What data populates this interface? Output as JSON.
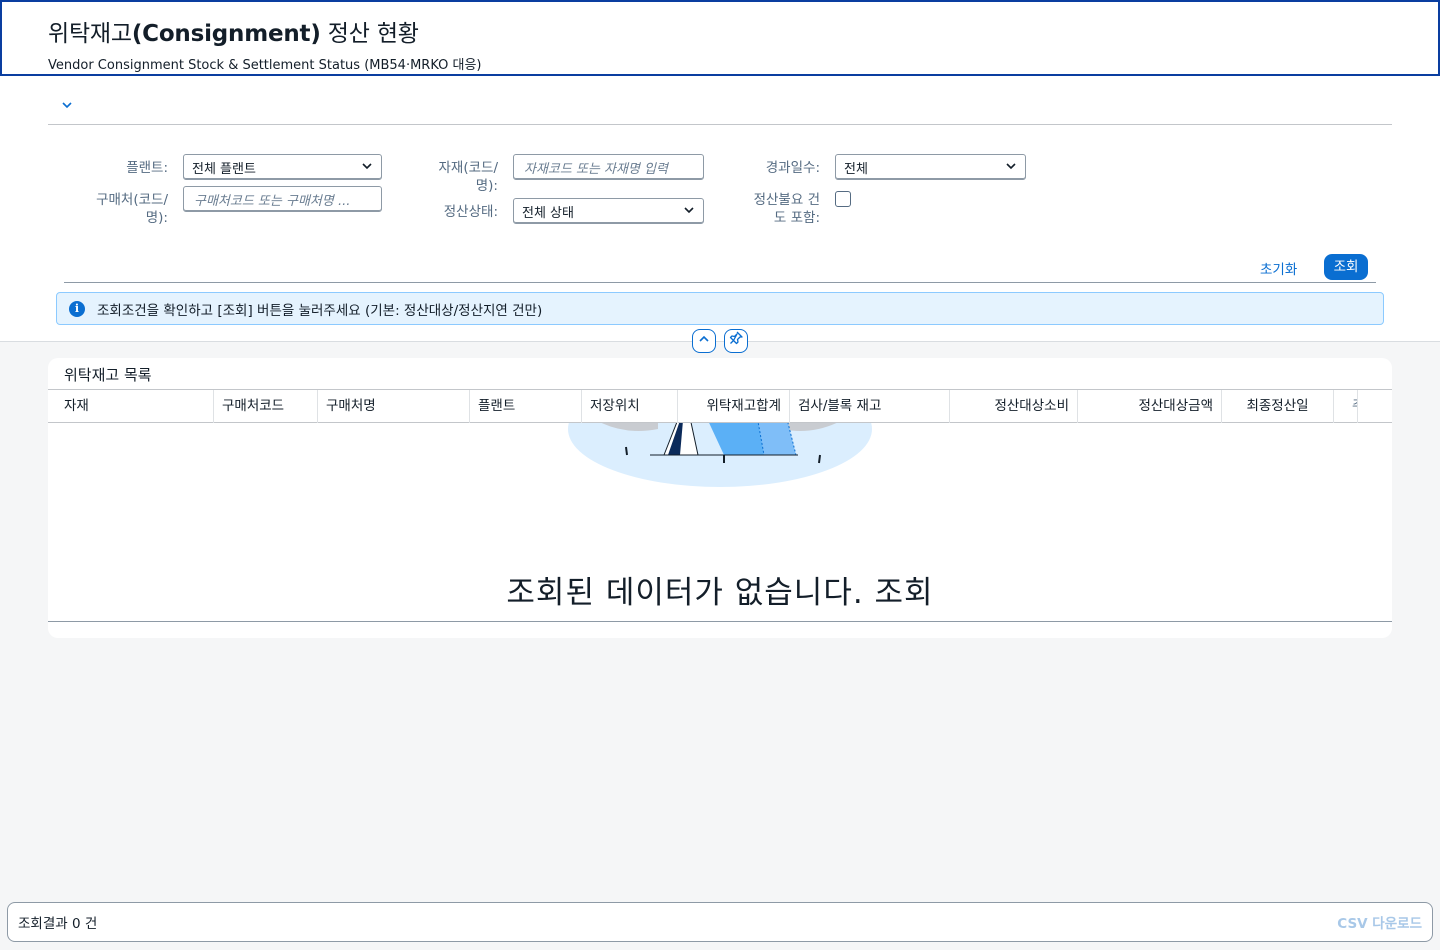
{
  "header": {
    "title_prefix": "위탁재고",
    "title_bold": "(Consignment)",
    "title_suffix": " 정산 현황",
    "subtitle": "Vendor Consignment Stock & Settlement Status (MB54·MRKO 대응)"
  },
  "filters": {
    "plant_label": "플랜트:",
    "plant_value": "전체 플랜트",
    "vendor_label": "구매처(코드/\n명):",
    "vendor_placeholder": "구매처코드 또는 구매처명 ...",
    "material_label": "자재(코드/\n명):",
    "material_placeholder": "자재코드 또는 자재명 입력",
    "status_label": "정산상태:",
    "status_value": "전체 상태",
    "days_label": "경과일수:",
    "days_value": "전체",
    "include_label": "정산불요 건\n도 포함:"
  },
  "toolbar": {
    "reset_label": "초기화",
    "search_label": "조회"
  },
  "info_message": "조회조건을 확인하고 [조회] 버튼을 눌러주세요 (기본: 정산대상/정산지연 건만)",
  "table": {
    "title": "위탁재고 목록",
    "columns": [
      "자재",
      "구매처코드",
      "구매처명",
      "플랜트",
      "저장위치",
      "위탁재고합계",
      "검사/블록 재고",
      "정산대상소비",
      "정산대상금액",
      "최종정산일",
      "주"
    ],
    "empty_message": "조회된 데이터가 없습니다. 조회"
  },
  "footer": {
    "result_count": "조회결과 0 건",
    "csv_label": "CSV 다운로드"
  },
  "colors": {
    "accent": "#0a6ed1",
    "header_border": "#0a3ea0",
    "info_bg": "#e5f3fe"
  }
}
